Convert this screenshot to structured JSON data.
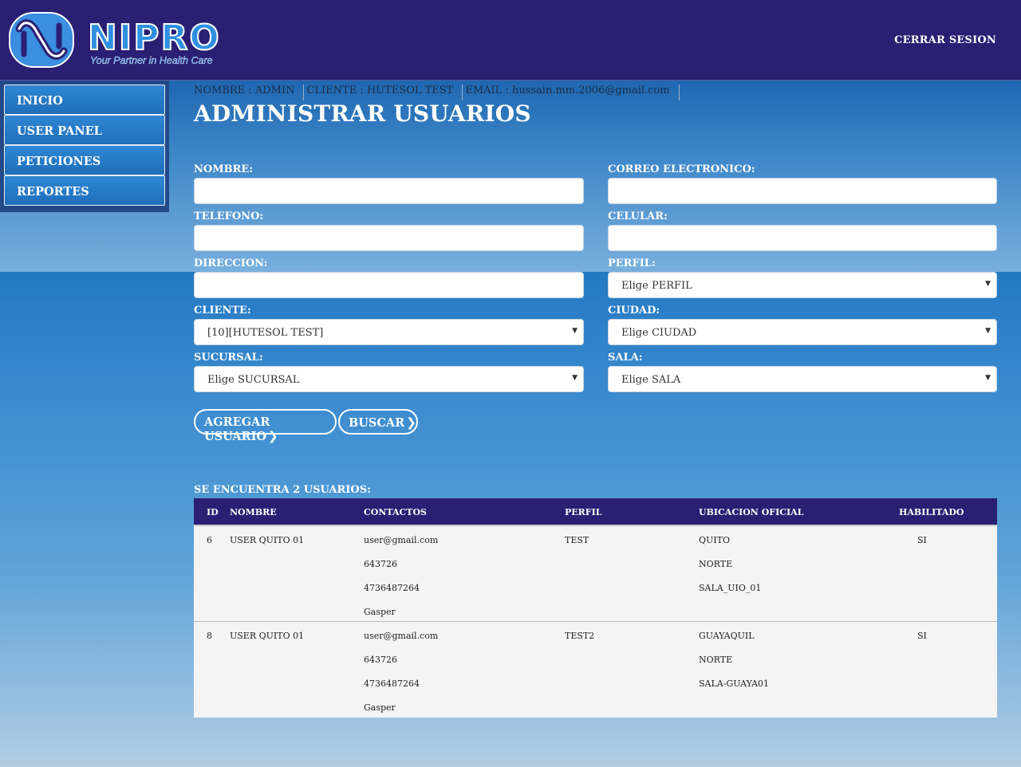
{
  "header": {
    "brand": "NIPRO",
    "tagline": "Your Partner in Health Care",
    "logout_label": "CERRAR SESION"
  },
  "sidebar": {
    "items": [
      {
        "label": "INICIO"
      },
      {
        "label": "USER PANEL"
      },
      {
        "label": "PETICIONES"
      },
      {
        "label": "REPORTES"
      }
    ]
  },
  "userinfo": {
    "nombre": "NOMBRE : ADMIN",
    "cliente": "CLIENTE : HUTESOL TEST",
    "email": "EMAIL : hussain.mm.2006@gmail.com"
  },
  "page_title": "ADMINISTRAR USUARIOS",
  "form": {
    "nombre_label": "NOMBRE:",
    "correo_label": "CORREO ELECTRONICO:",
    "telefono_label": "TELEFONO:",
    "celular_label": "CELULAR:",
    "direccion_label": "DIRECCION:",
    "perfil_label": "PERFIL:",
    "perfil_value": "Elige PERFIL",
    "cliente_label": "CLIENTE:",
    "cliente_value": "[10][HUTESOL TEST]",
    "ciudad_label": "CIUDAD:",
    "ciudad_value": "Elige CIUDAD",
    "sucursal_label": "SUCURSAL:",
    "sucursal_value": "Elige SUCURSAL",
    "sala_label": "SALA:",
    "sala_value": "Elige SALA"
  },
  "buttons": {
    "agregar": "AGREGAR USUARIO",
    "buscar": "BUSCAR"
  },
  "results_count": "SE ENCUENTRA 2 USUARIOS:",
  "table": {
    "headers": [
      "ID",
      "NOMBRE",
      "CONTACTOS",
      "PERFIL",
      "UBICACION OFICIAL",
      "HABILITADO"
    ],
    "rows": [
      {
        "id": "6",
        "nombre": "USER QUITO 01",
        "contactos": [
          "user@gmail.com",
          "643726",
          "4736487264",
          "Gasper"
        ],
        "perfil": "TEST",
        "ubicacion": [
          "QUITO",
          "NORTE",
          "SALA_UIO_01"
        ],
        "habilitado": "SI"
      },
      {
        "id": "8",
        "nombre": "USER QUITO 01",
        "contactos": [
          "user@gmail.com",
          "643726",
          "4736487264",
          "Gasper"
        ],
        "perfil": "TEST2",
        "ubicacion": [
          "GUAYAQUIL",
          "NORTE",
          "SALA-GUAYA01"
        ],
        "habilitado": "SI"
      }
    ]
  }
}
